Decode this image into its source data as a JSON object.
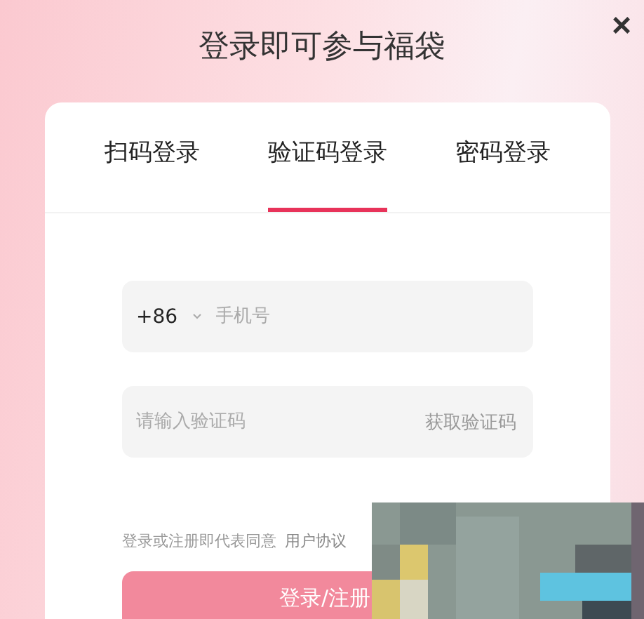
{
  "dialog": {
    "title": "登录即可参与福袋",
    "close": "×"
  },
  "tabs": [
    {
      "label": "扫码登录",
      "selected": false
    },
    {
      "label": "验证码登录",
      "selected": true
    },
    {
      "label": "密码登录",
      "selected": false
    }
  ],
  "phone_field": {
    "country_code": "+86",
    "placeholder": "手机号"
  },
  "code_field": {
    "placeholder": "请输入验证码",
    "action": "获取验证码"
  },
  "consent": {
    "text": "登录或注册即代表同意",
    "link": "用户协议"
  },
  "submit_button": {
    "label": "登录/注册"
  }
}
